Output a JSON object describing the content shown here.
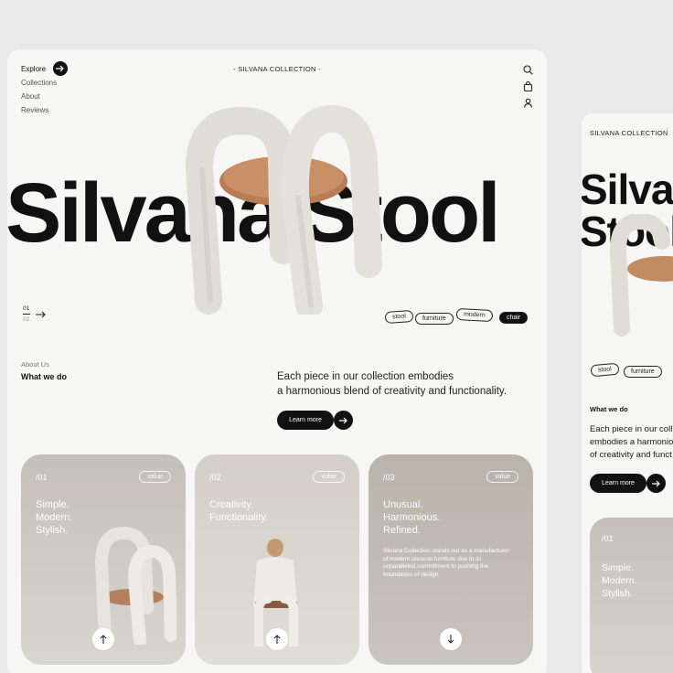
{
  "nav": {
    "items": [
      "Explore",
      "Collections",
      "About",
      "Reviews"
    ]
  },
  "brand": "- SILVANA COLLECTION -",
  "hero": {
    "title": "Silvana Stool",
    "page_current": "01",
    "page_total": "02"
  },
  "tags": [
    "stool",
    "furniture",
    "modern",
    "chair"
  ],
  "about": {
    "label": "About Us",
    "heading": "What we do",
    "line1": "Each piece in our collection embodies",
    "line2": "a harmonious blend of creativity and functionality.",
    "button": "Learn more"
  },
  "cards": [
    {
      "num": "/01",
      "pill": "value",
      "t1": "Simple.",
      "t2": "Modern.",
      "t3": "Stylish."
    },
    {
      "num": "/02",
      "pill": "value",
      "t1": "Creativity.",
      "t2": "Functionality."
    },
    {
      "num": "/03",
      "pill": "value",
      "t1": "Unusual.",
      "t2": "Harmonious.",
      "t3": "Refined.",
      "desc": "Silvana Collection stands out as a manufacturer of modern unusual furniture due to its unparalleled commitment to pushing the boundaries of design."
    }
  ],
  "mobile": {
    "brand": "SILVANA COLLECTION",
    "hero": "Silvana Stool",
    "tags": [
      "stool",
      "furniture"
    ],
    "heading": "What we do",
    "line1": "Each piece in our coll",
    "line2": "embodies a harmonio",
    "line3": "of creativity and funct",
    "button": "Learn more",
    "card": {
      "num": "/01",
      "t1": "Simple.",
      "t2": "Modern.",
      "t3": "Stylish."
    }
  },
  "colors": {
    "background": "#e9e9e9",
    "panel": "#f6f6f4",
    "accent": "#111111",
    "seat": "#c28c63",
    "fabric": "#e0ddd6"
  }
}
